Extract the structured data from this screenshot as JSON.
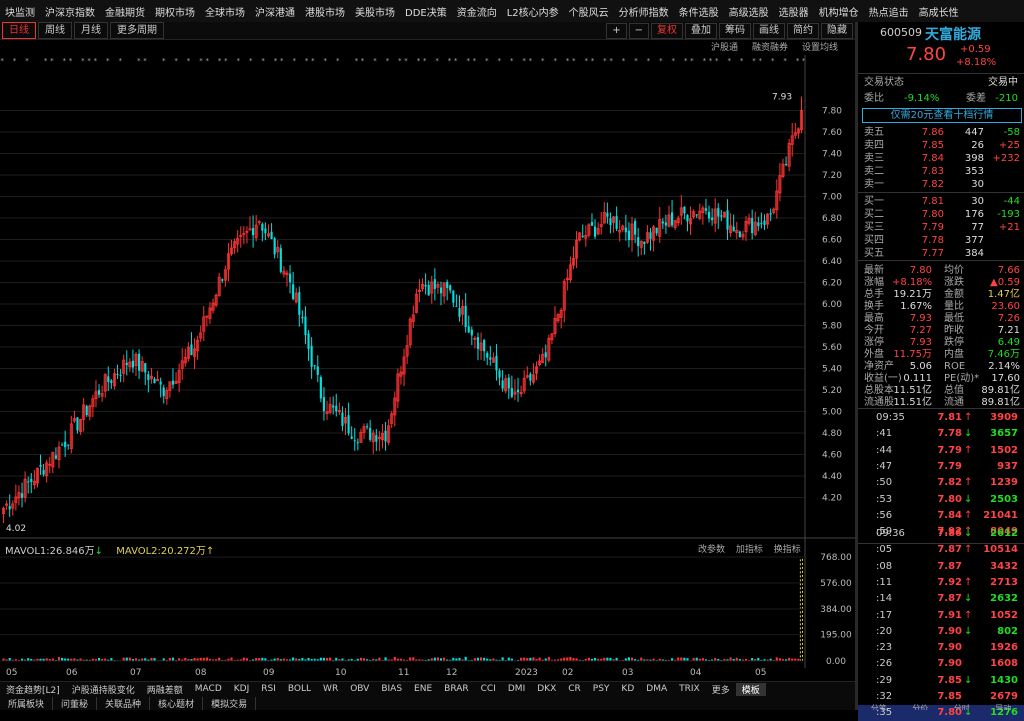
{
  "top_menu": [
    "块监测",
    "沪深京指数",
    "金融期货",
    "期权市场",
    "全球市场",
    "沪深港通",
    "港股市场",
    "美股市场",
    "DDE决策",
    "资金流向",
    "L2核心内参",
    "个股风云",
    "分析师指数",
    "条件选股",
    "高级选股",
    "选股器",
    "机构增仓",
    "热点追击",
    "高成长性"
  ],
  "toolbar": {
    "tabs": [
      "日线",
      "周线",
      "月线",
      "更多周期"
    ],
    "right": [
      "+",
      "−",
      "复权",
      "叠加",
      "筹码",
      "画线",
      "简约",
      "隐藏"
    ]
  },
  "subbar": [
    "沪股通",
    "融资融券",
    "设置均线"
  ],
  "price_axis": [
    "7.80",
    "7.60",
    "7.40",
    "7.20",
    "7.00",
    "6.80",
    "6.60",
    "6.40",
    "6.20",
    "6.00",
    "5.80",
    "5.60",
    "5.40",
    "5.20",
    "5.00",
    "4.80",
    "4.60",
    "4.40",
    "4.20"
  ],
  "annotations": {
    "high": "7.93",
    "low": "4.02"
  },
  "volume": {
    "mavol1": "MAVOL1:26.846万",
    "mavol2": "MAVOL2:20.272万",
    "tools": [
      "改参数",
      "加指标",
      "换指标"
    ],
    "axis": [
      "768.00",
      "576.00",
      "384.00",
      "195.00",
      "0.00"
    ]
  },
  "x_axis": [
    "05",
    "06",
    "07",
    "08",
    "09",
    "10",
    "11",
    "12",
    "2023",
    "02",
    "03",
    "04",
    "05"
  ],
  "indicators": [
    "资金趋势[L2]",
    "沪股通持股变化",
    "两融差额",
    "MACD",
    "KDJ",
    "RSI",
    "BOLL",
    "WR",
    "OBV",
    "BIAS",
    "ENE",
    "BRAR",
    "CCI",
    "DMI",
    "DKX",
    "CR",
    "PSY",
    "KD",
    "DMA",
    "TRIX",
    "更多",
    "模板"
  ],
  "bottom_tabs": [
    "所属板块",
    "问董秘",
    "关联品种",
    "核心题材",
    "模拟交易"
  ],
  "stock": {
    "code": "600509",
    "name": "天富能源",
    "price": "7.80",
    "change": "+0.59",
    "pct": "+8.18%",
    "status_label": "交易状态",
    "status": "交易中",
    "webi_label": "委比",
    "webi": "-9.14%",
    "weicha_label": "委差",
    "weicha": "-210",
    "promo": "仅需20元查看十档行情"
  },
  "orderbook": {
    "asks": [
      {
        "label": "卖五",
        "price": "7.86",
        "vol": "447",
        "chg": "-58"
      },
      {
        "label": "卖四",
        "price": "7.85",
        "vol": "26",
        "chg": "+25"
      },
      {
        "label": "卖三",
        "price": "7.84",
        "vol": "398",
        "chg": "+232"
      },
      {
        "label": "卖二",
        "price": "7.83",
        "vol": "353",
        "chg": ""
      },
      {
        "label": "卖一",
        "price": "7.82",
        "vol": "30",
        "chg": ""
      }
    ],
    "bids": [
      {
        "label": "买一",
        "price": "7.81",
        "vol": "30",
        "chg": "-44"
      },
      {
        "label": "买二",
        "price": "7.80",
        "vol": "176",
        "chg": "-193"
      },
      {
        "label": "买三",
        "price": "7.79",
        "vol": "77",
        "chg": "+21"
      },
      {
        "label": "买四",
        "price": "7.78",
        "vol": "377",
        "chg": ""
      },
      {
        "label": "买五",
        "price": "7.77",
        "vol": "384",
        "chg": ""
      }
    ]
  },
  "quote": [
    {
      "l": "最新",
      "v": "7.80",
      "c": "red",
      "r": "均价",
      "v2": "7.66",
      "c2": "red"
    },
    {
      "l": "涨幅",
      "v": "+8.18%",
      "c": "red",
      "r": "涨跌",
      "v2": "▲0.59",
      "c2": "red"
    },
    {
      "l": "总手",
      "v": "19.21万",
      "c": "white",
      "r": "金额",
      "v2": "1.47亿",
      "c2": "yellow"
    },
    {
      "l": "换手",
      "v": "1.67%",
      "c": "white",
      "r": "量比",
      "v2": "23.60",
      "c2": "red"
    },
    {
      "l": "最高",
      "v": "7.93",
      "c": "red",
      "r": "最低",
      "v2": "7.26",
      "c2": "red"
    },
    {
      "l": "今开",
      "v": "7.27",
      "c": "red",
      "r": "昨收",
      "v2": "7.21",
      "c2": "white"
    },
    {
      "l": "涨停",
      "v": "7.93",
      "c": "red",
      "r": "跌停",
      "v2": "6.49",
      "c2": "green"
    },
    {
      "l": "外盘",
      "v": "11.75万",
      "c": "red",
      "r": "内盘",
      "v2": "7.46万",
      "c2": "green"
    },
    {
      "l": "净资产",
      "v": "5.06",
      "c": "white",
      "r": "ROE",
      "v2": "2.14%",
      "c2": "white"
    },
    {
      "l": "收益(一)",
      "v": "0.111",
      "c": "white",
      "r": "PE(动)*",
      "v2": "17.60",
      "c2": "white"
    },
    {
      "l": "总股本",
      "v": "11.51亿",
      "c": "white",
      "r": "总值",
      "v2": "89.81亿",
      "c2": "white"
    },
    {
      "l": "流通股",
      "v": "11.51亿",
      "c": "white",
      "r": "流通",
      "v2": "89.81亿",
      "c2": "white"
    }
  ],
  "ticks1": [
    {
      "t": "09:35",
      "p": "7.81",
      "a": "↑",
      "v": "3909",
      "pc": "red",
      "vc": "red"
    },
    {
      "t": ":41",
      "p": "7.78",
      "a": "↓",
      "v": "3657",
      "pc": "red",
      "vc": "green"
    },
    {
      "t": ":44",
      "p": "7.79",
      "a": "↑",
      "v": "1502",
      "pc": "red",
      "vc": "red"
    },
    {
      "t": ":47",
      "p": "7.79",
      "a": "",
      "v": "937",
      "pc": "red",
      "vc": "red"
    },
    {
      "t": ":50",
      "p": "7.82",
      "a": "↑",
      "v": "1239",
      "pc": "red",
      "vc": "red"
    },
    {
      "t": ":53",
      "p": "7.80",
      "a": "↓",
      "v": "2503",
      "pc": "red",
      "vc": "green"
    },
    {
      "t": ":56",
      "p": "7.84",
      "a": "↑",
      "v": "21041",
      "pc": "red",
      "vc": "red"
    },
    {
      "t": ":59",
      "p": "7.92",
      "a": "↑",
      "v": "8049",
      "pc": "red",
      "vc": "red"
    }
  ],
  "ticks2": [
    {
      "t": "09:36",
      "p": "7.86",
      "a": "↓",
      "v": "2612",
      "pc": "red",
      "vc": "green"
    },
    {
      "t": ":05",
      "p": "7.87",
      "a": "↑",
      "v": "10514",
      "pc": "red",
      "vc": "red"
    },
    {
      "t": ":08",
      "p": "7.87",
      "a": "",
      "v": "3432",
      "pc": "red",
      "vc": "red"
    },
    {
      "t": ":11",
      "p": "7.92",
      "a": "↑",
      "v": "2713",
      "pc": "red",
      "vc": "red"
    },
    {
      "t": ":14",
      "p": "7.87",
      "a": "↓",
      "v": "2632",
      "pc": "red",
      "vc": "green"
    },
    {
      "t": ":17",
      "p": "7.91",
      "a": "↑",
      "v": "1052",
      "pc": "red",
      "vc": "red"
    },
    {
      "t": ":20",
      "p": "7.90",
      "a": "↓",
      "v": "802",
      "pc": "red",
      "vc": "green"
    },
    {
      "t": ":23",
      "p": "7.90",
      "a": "",
      "v": "1926",
      "pc": "red",
      "vc": "red"
    },
    {
      "t": ":26",
      "p": "7.90",
      "a": "",
      "v": "1608",
      "pc": "red",
      "vc": "red"
    },
    {
      "t": ":29",
      "p": "7.85",
      "a": "↓",
      "v": "1430",
      "pc": "red",
      "vc": "green"
    },
    {
      "t": ":32",
      "p": "7.85",
      "a": "",
      "v": "2679",
      "pc": "red",
      "vc": "red"
    },
    {
      "t": ":35",
      "p": "7.80",
      "a": "↓",
      "v": "1276",
      "pc": "red",
      "vc": "green"
    }
  ],
  "right_tabs": [
    "分笔",
    "分价",
    "分时",
    "异动"
  ],
  "colors": {
    "up": "#ff3333",
    "down": "#00e0e0",
    "bg": "#000000",
    "accent": "#33aadd"
  },
  "chart_data": {
    "type": "candlestick",
    "x_labels": [
      "05",
      "06",
      "07",
      "08",
      "09",
      "10",
      "11",
      "12",
      "2023",
      "02",
      "03",
      "04",
      "05"
    ],
    "anchors_close": [
      4.1,
      4.4,
      4.75,
      5.2,
      5.5,
      5.2,
      5.6,
      6.4,
      6.8,
      6.2,
      5.1,
      4.8,
      4.8,
      6.2,
      6.1,
      5.6,
      5.1,
      5.5,
      6.6,
      6.8,
      6.6,
      6.8,
      6.9,
      6.7,
      6.8,
      7.8
    ],
    "bars": 260,
    "ylim": [
      4.0,
      8.0
    ],
    "annotations": {
      "high": 7.93,
      "low": 4.02
    }
  }
}
